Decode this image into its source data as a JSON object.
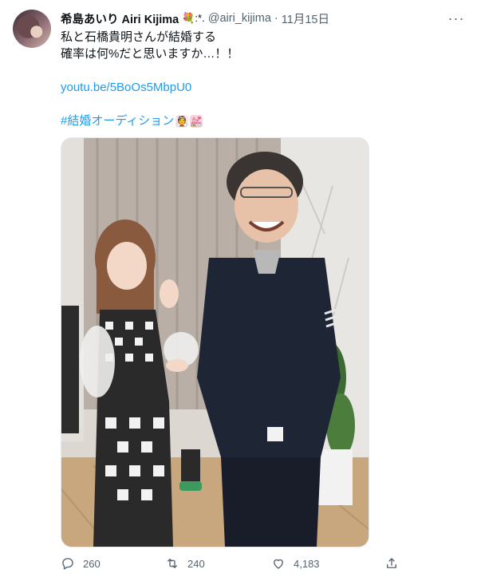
{
  "tweet": {
    "display_name": "希島あいり Airi Kijima",
    "name_emoji": "💐:*.",
    "handle": "@airi_kijima",
    "separator": "·",
    "date": "11月15日",
    "more_label": "···",
    "text_line1": "私と石橋貴明さんが結婚する",
    "text_line2": "確率は何%だと思いますか…！！",
    "link": "youtu.be/5BoOs5MbpU0",
    "hashtag": "#結婚オーディション",
    "hashtag_emojis": [
      "bride-emoji",
      "wedding-chapel-emoji"
    ]
  },
  "actions": {
    "replies": "260",
    "retweets": "240",
    "likes": "4,183",
    "icons": [
      "reply-icon",
      "retweet-icon",
      "like-icon",
      "share-icon"
    ]
  },
  "colors": {
    "link": "#1d9bf0",
    "text": "#0f1419",
    "muted": "#536471"
  }
}
